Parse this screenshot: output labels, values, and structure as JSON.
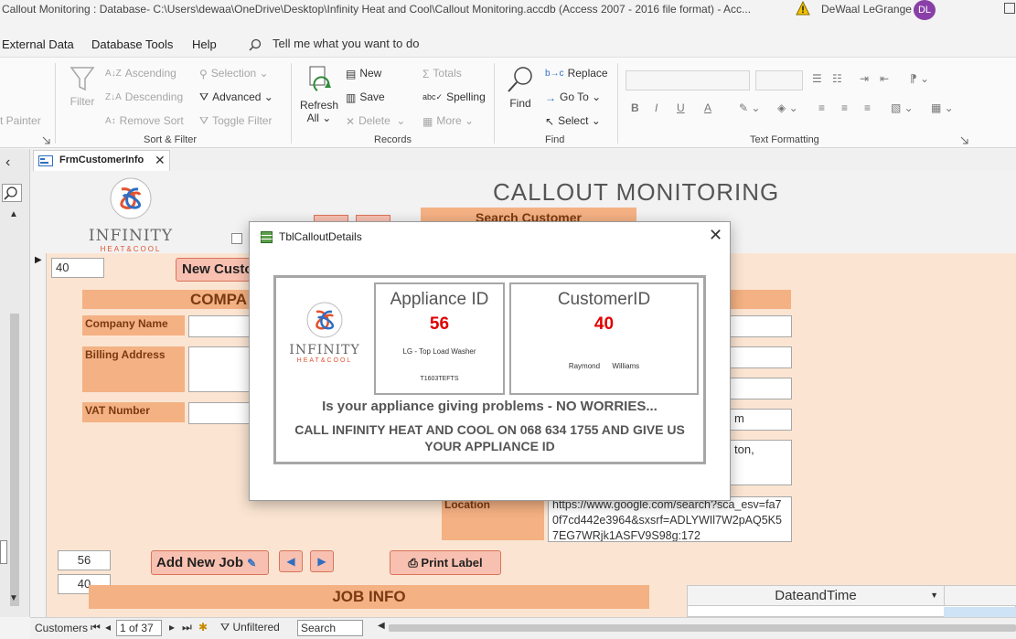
{
  "window": {
    "title": "Callout Monitoring : Database- C:\\Users\\dewaa\\OneDrive\\Desktop\\Infinity Heat and Cool\\Callout Monitoring.accdb (Access 2007 - 2016 file format)  -  Acc...",
    "user_name": "DeWaal LeGrange",
    "user_initials": "DL"
  },
  "menu": {
    "items": [
      "External Data",
      "Database Tools",
      "Help"
    ],
    "tell_me": "Tell me what you want to do"
  },
  "ribbon": {
    "clipboard": {
      "format_painter": "t Painter"
    },
    "sort_filter": {
      "filter": "Filter",
      "ascending": "Ascending",
      "descending": "Descending",
      "remove_sort": "Remove Sort",
      "selection": "Selection",
      "advanced": "Advanced",
      "toggle_filter": "Toggle Filter",
      "label": "Sort & Filter"
    },
    "records": {
      "refresh": "Refresh",
      "refresh_all": "All",
      "new": "New",
      "save": "Save",
      "delete": "Delete",
      "totals": "Totals",
      "spelling": "Spelling",
      "more": "More",
      "label": "Records"
    },
    "find": {
      "find": "Find",
      "replace": "Replace",
      "go_to": "Go To",
      "select": "Select",
      "label": "Find"
    },
    "text_formatting": {
      "bold": "B",
      "italic": "I",
      "underline": "U",
      "font_color": "A",
      "label": "Text Formatting"
    }
  },
  "doc_tab": {
    "label": "FrmCustomerInfo"
  },
  "form": {
    "title": "CALLOUT MONITORING",
    "search_customer": "Search Customer",
    "customer_id_field": "40",
    "new_customer_button": "New Custo",
    "company_band": "COMPA",
    "company_name_label": "Company Name",
    "billing_address_label": "Billing Address",
    "vat_number_label": "VAT Number",
    "right_field_partial_1": "m",
    "right_field_partial_2": "ton,",
    "location_label": "Location",
    "location_value": "https://www.google.com/search?sca_esv=fa70f7cd442e3964&sxsrf=ADLYWIl7W2pAQ5K57EG7WRjk1ASFV9S98g:172",
    "appliance_id_field": "56",
    "customer_id_field_2": "40",
    "add_new_job_button": "Add New Job",
    "print_label_button": "Print Label",
    "job_info_band": "JOB INFO",
    "dateandtime_header": "DateandTime"
  },
  "status": {
    "object_label": "Customers",
    "record_position": "1 of 37",
    "filter_state": "Unfiltered",
    "search_placeholder": "Search"
  },
  "popup": {
    "title": "TblCalloutDetails",
    "logo_name": "INFINITY",
    "logo_sub": "HEAT&COOL",
    "appliance_id_heading": "Appliance ID",
    "appliance_id_value": "56",
    "appliance_description": "LG - Top Load Washer",
    "appliance_serial": "T1603TEFTS",
    "customer_id_heading": "CustomerID",
    "customer_id_value": "40",
    "customer_first_name": "Raymond",
    "customer_last_name": "Williams",
    "message_line_1": "Is your appliance giving problems - NO WORRIES...",
    "message_line_2": "CALL INFINITY HEAT AND COOL ON 068 634 1755 AND GIVE US YOUR APPLIANCE ID"
  },
  "colors": {
    "accent_orange": "#f4b183",
    "form_background": "#fbe5d2",
    "id_value_red": "#e00000",
    "avatar_purple": "#8a3fa8"
  }
}
